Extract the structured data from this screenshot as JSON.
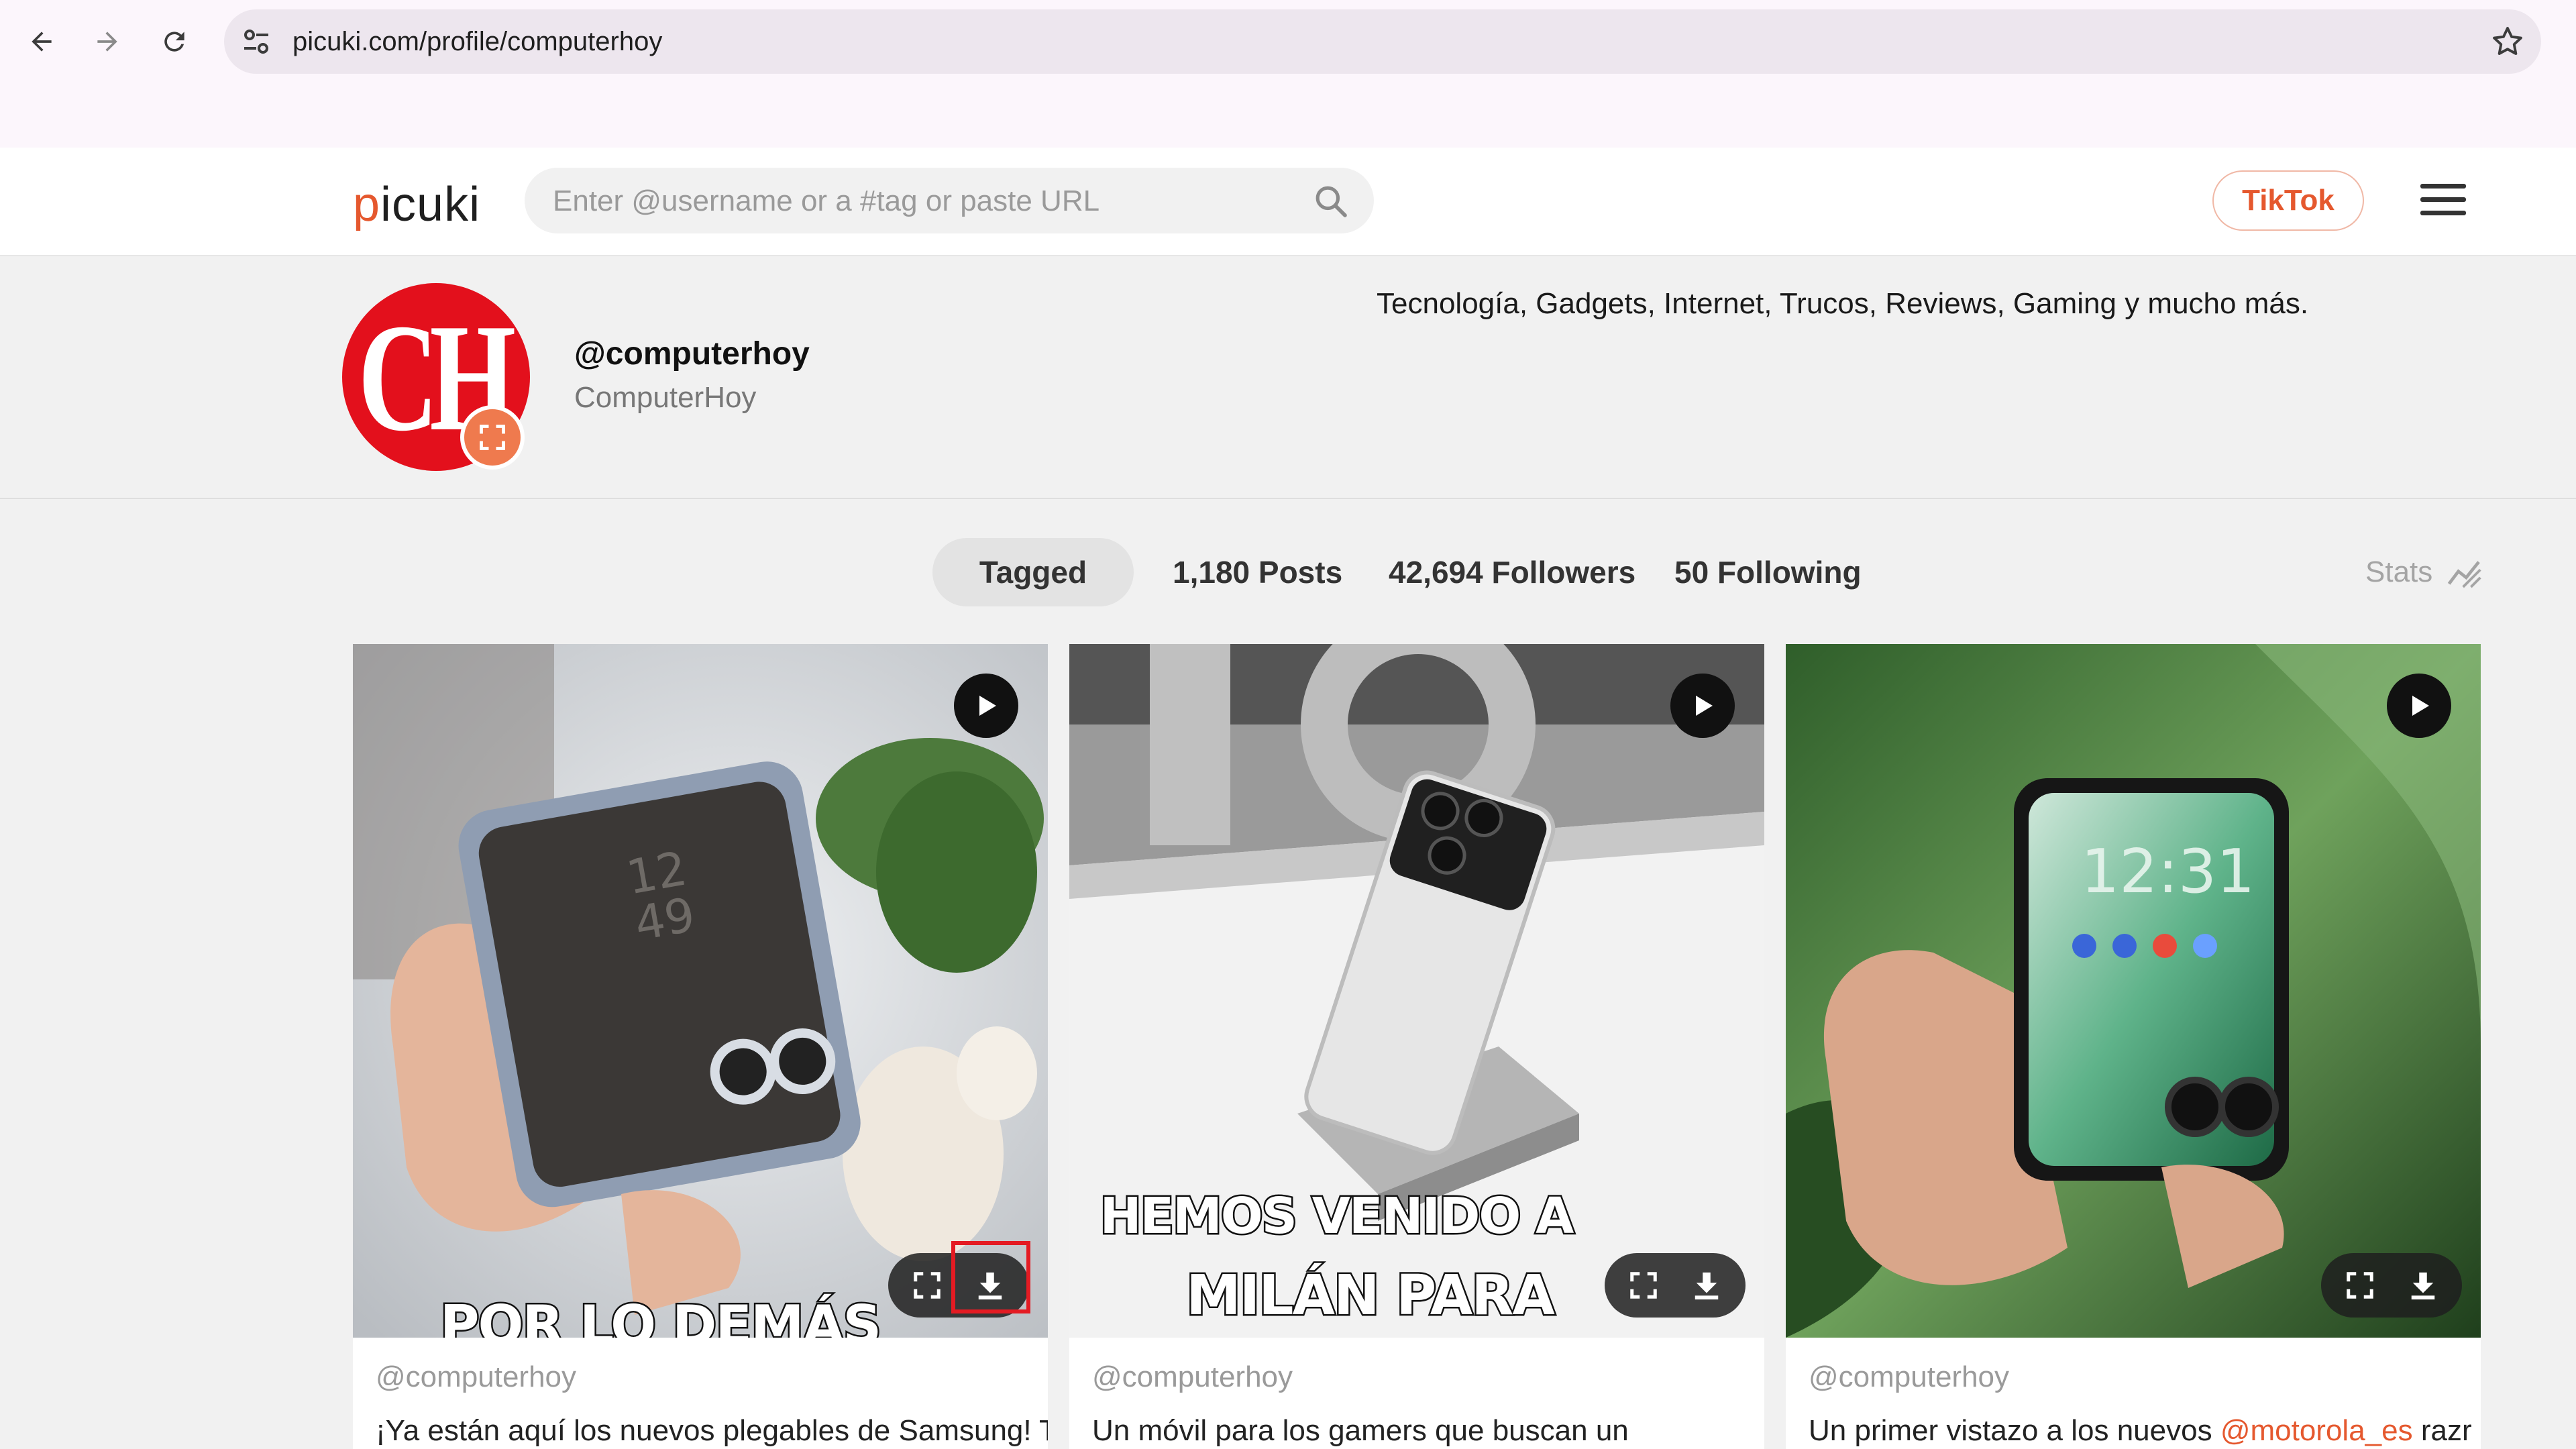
{
  "browser": {
    "url": "picuki.com/profile/computerhoy",
    "icons": [
      "back-icon",
      "forward-icon",
      "reload-icon",
      "site-info-icon",
      "bookmark-star-icon"
    ]
  },
  "header": {
    "logo": "picuki",
    "logo_first_letter": "p",
    "logo_rest": "icuki",
    "search_placeholder": "Enter @username or a #tag or paste URL",
    "tiktok_label": "TikTok",
    "accent_color": "#e5582e"
  },
  "profile": {
    "avatar_text": "CH",
    "handle": "@computerhoy",
    "name": "ComputerHoy",
    "bio": "Tecnología, Gadgets, Internet, Trucos, Reviews, Gaming y mucho más."
  },
  "stats": {
    "tagged": "Tagged",
    "posts": "1,180 Posts",
    "followers": "42,694 Followers",
    "following": "50 Following",
    "stats_label": "Stats"
  },
  "posts": [
    {
      "author": "@computerhoy",
      "overlay_lines": [
        "POR LO DEMÁS"
      ],
      "description_start": "¡Ya están aquí los nuevos plegables de Samsung! Te",
      "download_highlighted": true
    },
    {
      "author": "@computerhoy",
      "overlay_lines": [
        "HEMOS VENIDO A",
        "MILÁN PARA"
      ],
      "description_start": "Un móvil para los gamers que buscan un",
      "download_highlighted": false
    },
    {
      "author": "@computerhoy",
      "overlay_lines": [],
      "description_start": "Un primer vistazo a los nuevos ",
      "description_mention": "@motorola_es",
      "description_end": " razr",
      "download_highlighted": false
    }
  ]
}
